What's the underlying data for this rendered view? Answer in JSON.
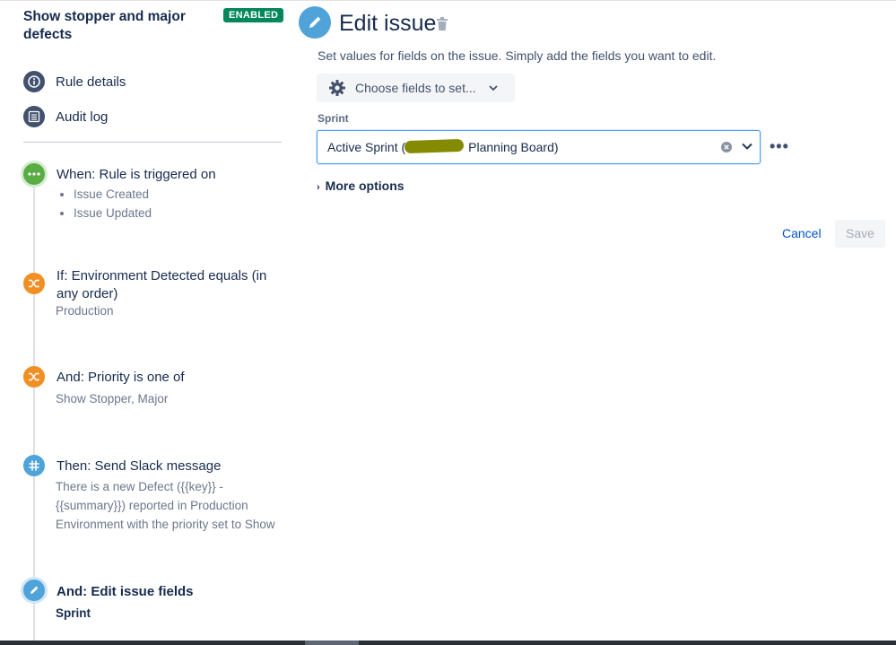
{
  "sidebar": {
    "rule_title": "Show stopper and major defects",
    "status_badge": "ENABLED",
    "nav": [
      {
        "label": "Rule details",
        "icon": "info-icon"
      },
      {
        "label": "Audit log",
        "icon": "list-icon"
      }
    ],
    "components": [
      {
        "kind": "trigger",
        "title": "When: Rule is triggered on",
        "items": [
          "Issue Created",
          "Issue Updated"
        ],
        "icon": "more-icon",
        "color": "#5aac44"
      },
      {
        "kind": "condition",
        "title": "If: Environment Detected equals (in any order)",
        "subtitle": "Production",
        "icon": "shuffle-icon",
        "color": "#f18f25"
      },
      {
        "kind": "condition",
        "title": "And: Priority is one of",
        "subtitle": "Show Stopper, Major",
        "icon": "shuffle-icon",
        "color": "#f18f25"
      },
      {
        "kind": "action",
        "title": "Then: Send Slack message",
        "subtitle": "There is a new Defect ({{key}} - {{summary}}) reported in Production Environment with the priority set to Show",
        "icon": "slack-icon",
        "color": "#4fa3d9"
      },
      {
        "kind": "action",
        "title": "And: Edit issue fields",
        "subtitle": "Sprint",
        "icon": "pencil-icon",
        "color": "#4fa3d9"
      }
    ]
  },
  "main": {
    "title": "Edit issue",
    "description": "Set values for fields on the issue. Simply add the fields you want to edit.",
    "choose_fields_label": "Choose fields to set...",
    "sprint_label": "Sprint",
    "sprint_value": "Active Sprint (",
    "sprint_value_end": "Planning Board)",
    "more_options_label": "More options",
    "cancel_label": "Cancel",
    "save_label": "Save"
  },
  "colors": {
    "accent": "#0052cc",
    "enabled_badge": "#00875a",
    "trigger_green": "#5aac44",
    "condition_orange": "#f18f25",
    "action_blue": "#4fa3d9"
  }
}
